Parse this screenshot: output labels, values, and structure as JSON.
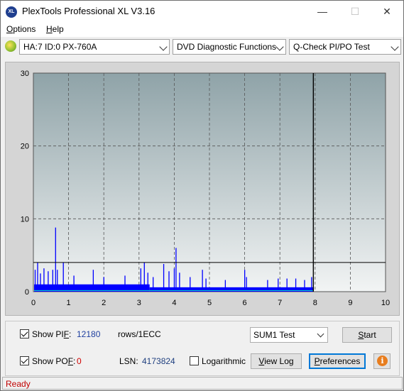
{
  "window": {
    "title": "PlexTools Professional XL V3.16",
    "icon_text": "XL",
    "minimize_glyph": "—",
    "maximize_glyph": "☐",
    "close_glyph": "✕"
  },
  "menu": {
    "options": {
      "mnemonic": "O",
      "rest": "ptions"
    },
    "help": {
      "mnemonic": "H",
      "rest": "elp"
    }
  },
  "toolbar": {
    "drive": "HA:7 ID:0  PX-760A",
    "function": "DVD Diagnostic Functions",
    "test": "Q-Check PI/PO Test"
  },
  "chart_data": {
    "type": "bar",
    "xlim": [
      0,
      10
    ],
    "ylim": [
      0,
      30
    ],
    "x_ticks": [
      "0",
      "1",
      "2",
      "3",
      "4",
      "5",
      "6",
      "7",
      "8",
      "9",
      "10"
    ],
    "y_ticks": [
      "0",
      "10",
      "20",
      "30"
    ],
    "threshold_line": 4,
    "end_marker_x": 7.95,
    "grid": true,
    "colors": {
      "plot_bg_top": "#8fa3a8",
      "plot_bg_bottom": "#f2f4f4",
      "pif_bars": "#0000ff",
      "pof_trace": "#00c8c8",
      "end_marker": "#000000"
    },
    "series": [
      {
        "name": "PIF",
        "spikes": [
          {
            "x": 0.05,
            "y": 3.0
          },
          {
            "x": 0.12,
            "y": 4.0
          },
          {
            "x": 0.2,
            "y": 2.5
          },
          {
            "x": 0.3,
            "y": 3.2
          },
          {
            "x": 0.42,
            "y": 2.8
          },
          {
            "x": 0.55,
            "y": 3.0
          },
          {
            "x": 0.63,
            "y": 8.8
          },
          {
            "x": 0.68,
            "y": 3.0
          },
          {
            "x": 0.85,
            "y": 4.0
          },
          {
            "x": 1.15,
            "y": 2.2
          },
          {
            "x": 1.7,
            "y": 3.0
          },
          {
            "x": 2.0,
            "y": 2.0
          },
          {
            "x": 2.6,
            "y": 2.2
          },
          {
            "x": 3.05,
            "y": 3.2
          },
          {
            "x": 3.15,
            "y": 4.0
          },
          {
            "x": 3.25,
            "y": 2.6
          },
          {
            "x": 3.4,
            "y": 2.0
          },
          {
            "x": 3.7,
            "y": 3.8
          },
          {
            "x": 3.85,
            "y": 2.8
          },
          {
            "x": 4.0,
            "y": 3.2
          },
          {
            "x": 4.05,
            "y": 6.0
          },
          {
            "x": 4.15,
            "y": 2.6
          },
          {
            "x": 4.45,
            "y": 2.0
          },
          {
            "x": 4.8,
            "y": 3.0
          },
          {
            "x": 4.9,
            "y": 1.8
          },
          {
            "x": 5.45,
            "y": 1.6
          },
          {
            "x": 6.0,
            "y": 3.0
          },
          {
            "x": 6.05,
            "y": 2.0
          },
          {
            "x": 6.65,
            "y": 1.6
          },
          {
            "x": 6.95,
            "y": 1.8
          },
          {
            "x": 7.2,
            "y": 1.8
          },
          {
            "x": 7.45,
            "y": 1.8
          },
          {
            "x": 7.7,
            "y": 1.6
          },
          {
            "x": 7.9,
            "y": 2.0
          }
        ]
      },
      {
        "name": "POF",
        "values": [
          0
        ]
      }
    ]
  },
  "controls": {
    "show_pif": {
      "checked": true,
      "label_prefix": "Show PI",
      "mnemonic": "F",
      "label_suffix": ":",
      "value": "12180",
      "unit": "rows/1ECC"
    },
    "show_pof": {
      "checked": true,
      "label_prefix": "Show PO",
      "mnemonic": "F",
      "label_suffix": ":",
      "value": "0"
    },
    "lsn_label": "LSN:",
    "lsn_value": "4173824",
    "logarithmic": {
      "checked": false,
      "label": "Logarithmic"
    },
    "sum_select": "SUM1 Test",
    "start_button": {
      "mnemonic": "S",
      "rest": "tart"
    },
    "viewlog_button": {
      "mnemonic": "V",
      "rest": "iew Log"
    },
    "preferences_button": {
      "mnemonic": "P",
      "rest": "references"
    }
  },
  "status": {
    "text": "Ready",
    "color": "#c00000"
  }
}
